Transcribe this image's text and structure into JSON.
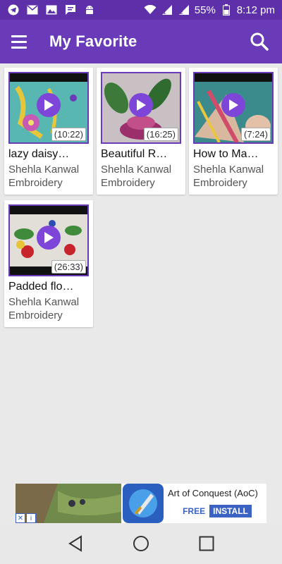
{
  "status_bar": {
    "battery": "55%",
    "time": "8:12 pm",
    "icons": [
      "telegram-icon",
      "mail-icon",
      "image-icon",
      "message-icon",
      "android-icon",
      "wifi-icon",
      "signal-1-icon",
      "signal-2-icon",
      "battery-icon"
    ]
  },
  "app_bar": {
    "title": "My Favorite",
    "menu_icon": "hamburger-icon",
    "search_icon": "search-icon"
  },
  "videos": [
    {
      "title": "lazy daisy…",
      "channel": "Shehla Kanwal Embroidery",
      "duration": "(10:22)"
    },
    {
      "title": "Beautiful R…",
      "channel": "Shehla Kanwal Embroidery",
      "duration": "(16:25)"
    },
    {
      "title": "How to Ma…",
      "channel": "Shehla Kanwal Embroidery",
      "duration": "(7:24)"
    },
    {
      "title": "Padded flo…",
      "channel": "Shehla Kanwal Embroidery",
      "duration": "(26:33)"
    }
  ],
  "ad": {
    "title": "Art of Conquest (AoC)",
    "price": "FREE",
    "cta": "INSTALL"
  },
  "colors": {
    "status_bar": "#5d2fa8",
    "app_bar": "#6a3bb8",
    "accent": "#7d45d8",
    "background": "#e9e9e9"
  }
}
